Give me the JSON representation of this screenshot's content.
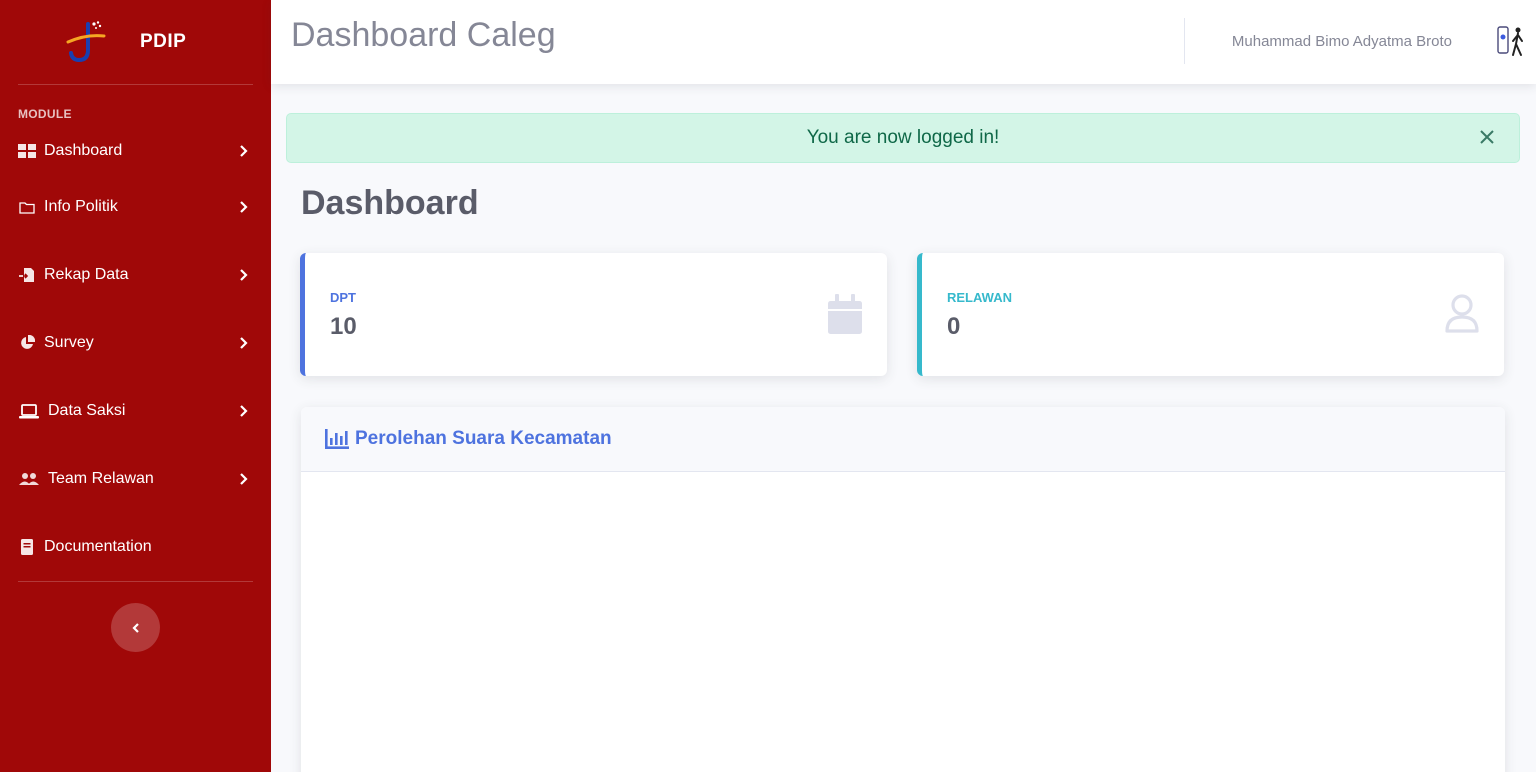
{
  "sidebar": {
    "brand": "PDIP",
    "heading": "MODULE",
    "items": [
      {
        "label": "Dashboard",
        "icon": "dashboard-grid-icon"
      },
      {
        "label": "Info Politik",
        "icon": "folder-icon"
      },
      {
        "label": "Rekap Data",
        "icon": "file-import-icon"
      },
      {
        "label": "Survey",
        "icon": "pie-chart-icon"
      },
      {
        "label": "Data Saksi",
        "icon": "laptop-icon"
      },
      {
        "label": "Team Relawan",
        "icon": "users-icon"
      },
      {
        "label": "Documentation",
        "icon": "book-icon"
      }
    ]
  },
  "topbar": {
    "title": "Dashboard Caleg",
    "user_name": "Muhammad Bimo Adyatma Broto"
  },
  "alert": {
    "message": "You are now logged in!"
  },
  "main": {
    "page_title": "Dashboard",
    "stats": [
      {
        "label": "DPT",
        "value": "10",
        "icon": "calendar-icon",
        "color": "#4e73df"
      },
      {
        "label": "RELAWAN",
        "value": "0",
        "icon": "user-icon",
        "color": "#36b9cc"
      }
    ],
    "chart_card": {
      "title": "Perolehan Suara Kecamatan",
      "icon": "chart-bar-icon"
    }
  },
  "colors": {
    "sidebar_bg": "#a00808",
    "primary": "#4e73df",
    "info": "#36b9cc",
    "alert_bg": "#d3f5e7",
    "alert_text": "#0f6848"
  }
}
